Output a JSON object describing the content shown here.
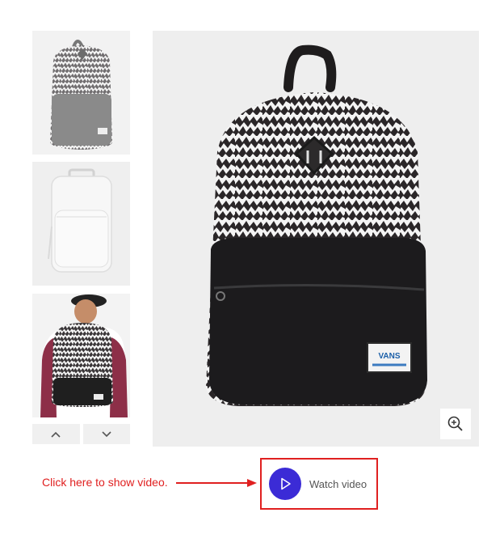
{
  "gallery": {
    "thumbnails": [
      {
        "name": "thumbnail-print-backpack"
      },
      {
        "name": "thumbnail-white-backpack"
      },
      {
        "name": "thumbnail-model-wearing-backpack"
      }
    ],
    "nav_up_icon": "chevron-up-icon",
    "nav_down_icon": "chevron-down-icon"
  },
  "main_image": {
    "brand_patch_text": "VANS",
    "zoom_icon": "zoom-in-icon"
  },
  "annotation": {
    "hint_text": "Click here to show video.",
    "accent_color": "#e02020"
  },
  "video": {
    "label": "Watch video",
    "play_icon": "play-icon",
    "button_color": "#3b2bd6"
  }
}
